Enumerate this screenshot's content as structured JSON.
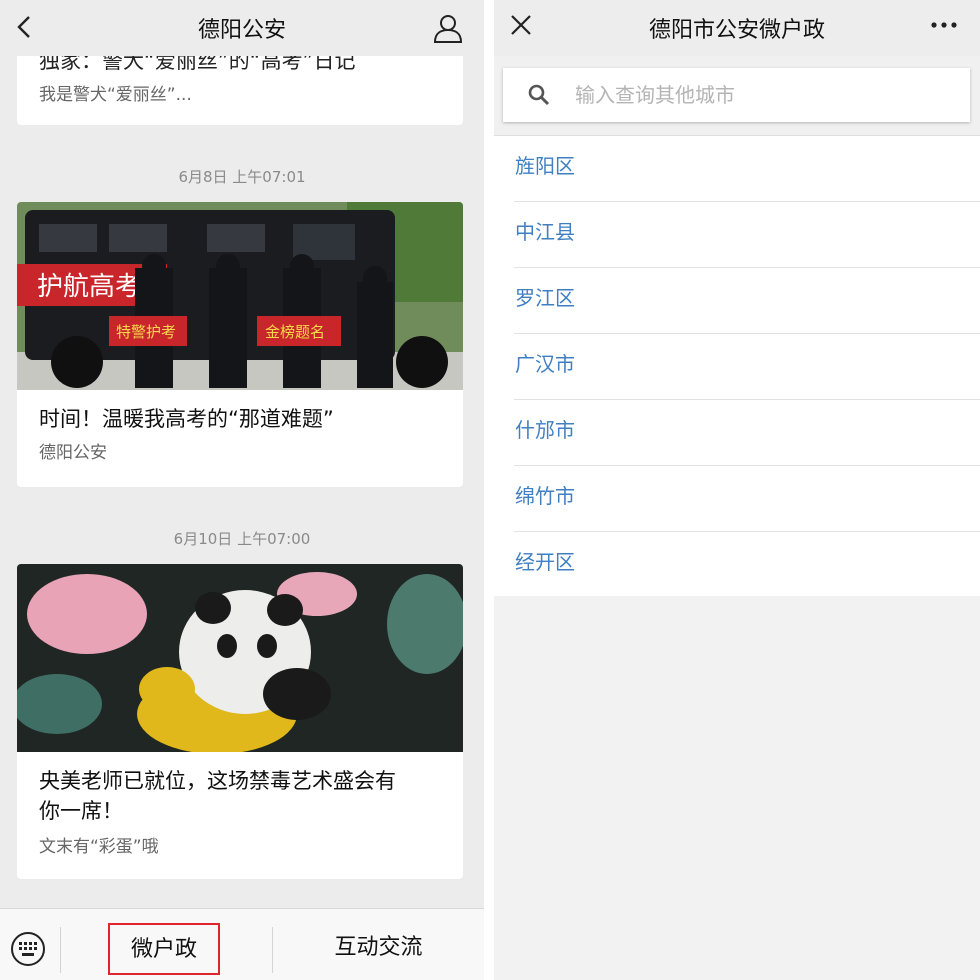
{
  "left": {
    "title": "德阳公安",
    "feed": [
      {
        "title": "独家：警犬“爱丽丝”的“高考”日记",
        "subtitle": "我是警犬“爱丽丝”..."
      },
      {
        "time": "6月8日 上午07:01",
        "image_label": "护航高考",
        "sign_left": "特警护考",
        "sign_right": "金榜题名",
        "title": "时间！温暖我高考的“那道难题”",
        "subtitle": "德阳公安"
      },
      {
        "time": "6月10日 上午07:00",
        "title_line1": "央美老师已就位，这场禁毒艺术盛会有",
        "title_line2": "你一席！",
        "subtitle": "文末有“彩蛋”哦"
      }
    ],
    "footer": {
      "menu1": "微户政",
      "menu2": "互动交流"
    }
  },
  "right": {
    "title": "德阳市公安微户政",
    "search": {
      "placeholder": "输入查询其他城市",
      "value": ""
    },
    "districts": [
      "旌阳区",
      "中江县",
      "罗江区",
      "广汉市",
      "什邡市",
      "绵竹市",
      "经开区"
    ]
  },
  "colors": {
    "link_blue": "#3f7fc2",
    "highlight_red": "#e0262c",
    "bg_gray": "#ececec"
  }
}
